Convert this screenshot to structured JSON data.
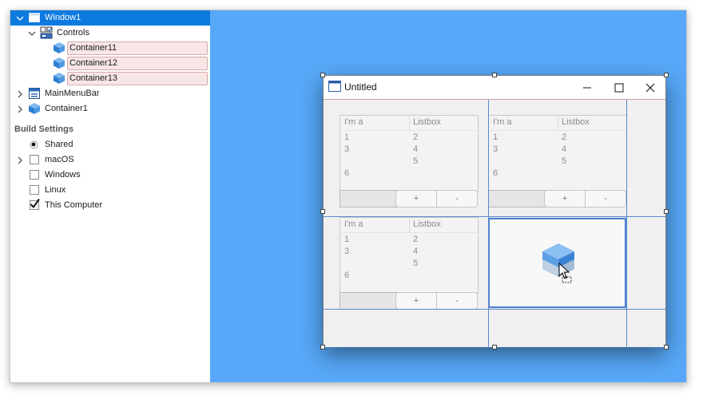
{
  "navigator": {
    "tree": [
      {
        "label": "Window1",
        "selected": true,
        "expanded": true,
        "icon": "window-icon"
      },
      {
        "label": "Controls",
        "expanded": true,
        "icon": "controls-icon"
      },
      {
        "label": "Container11",
        "icon": "container-icon"
      },
      {
        "label": "Container12",
        "icon": "container-icon"
      },
      {
        "label": "Container13",
        "icon": "container-icon"
      },
      {
        "label": "MainMenuBar",
        "expanded": false,
        "icon": "menubar-icon"
      },
      {
        "label": "Container1",
        "expanded": false,
        "icon": "container-icon"
      }
    ],
    "build_settings": {
      "title": "Build Settings",
      "items": [
        {
          "label": "Shared",
          "kind": "radio",
          "checked": true
        },
        {
          "label": "macOS",
          "kind": "checkbox",
          "checked": false,
          "expandable": true
        },
        {
          "label": "Windows",
          "kind": "checkbox",
          "checked": false
        },
        {
          "label": "Linux",
          "kind": "checkbox",
          "checked": false
        },
        {
          "label": "This Computer",
          "kind": "checkbox",
          "checked": true
        }
      ]
    }
  },
  "window": {
    "title": "Untitled",
    "controls": {
      "minimize": "minimize-icon",
      "maximize": "maximize-icon",
      "close": "close-icon"
    },
    "listboxes": [
      {
        "headers": [
          "I'm a",
          "Listbox"
        ],
        "col1": [
          "1",
          "3",
          "",
          "6"
        ],
        "col2": [
          "2",
          "4",
          "5",
          ""
        ],
        "add_label": "+",
        "remove_label": "-"
      },
      {
        "headers": [
          "I'm a",
          "Listbox"
        ],
        "col1": [
          "1",
          "3",
          "",
          "6"
        ],
        "col2": [
          "2",
          "4",
          "5",
          ""
        ],
        "add_label": "+",
        "remove_label": "-"
      },
      {
        "headers": [
          "I'm a",
          "Listbox"
        ],
        "col1": [
          "1",
          "3",
          "",
          "6"
        ],
        "col2": [
          "2",
          "4",
          "5",
          ""
        ],
        "add_label": "+",
        "remove_label": "-"
      }
    ]
  },
  "colors": {
    "canvas_background": "#57a8f8",
    "selection": "#0d7adf",
    "container_highlight": "#f8e6e6",
    "guide_line": "#5b88c9"
  }
}
